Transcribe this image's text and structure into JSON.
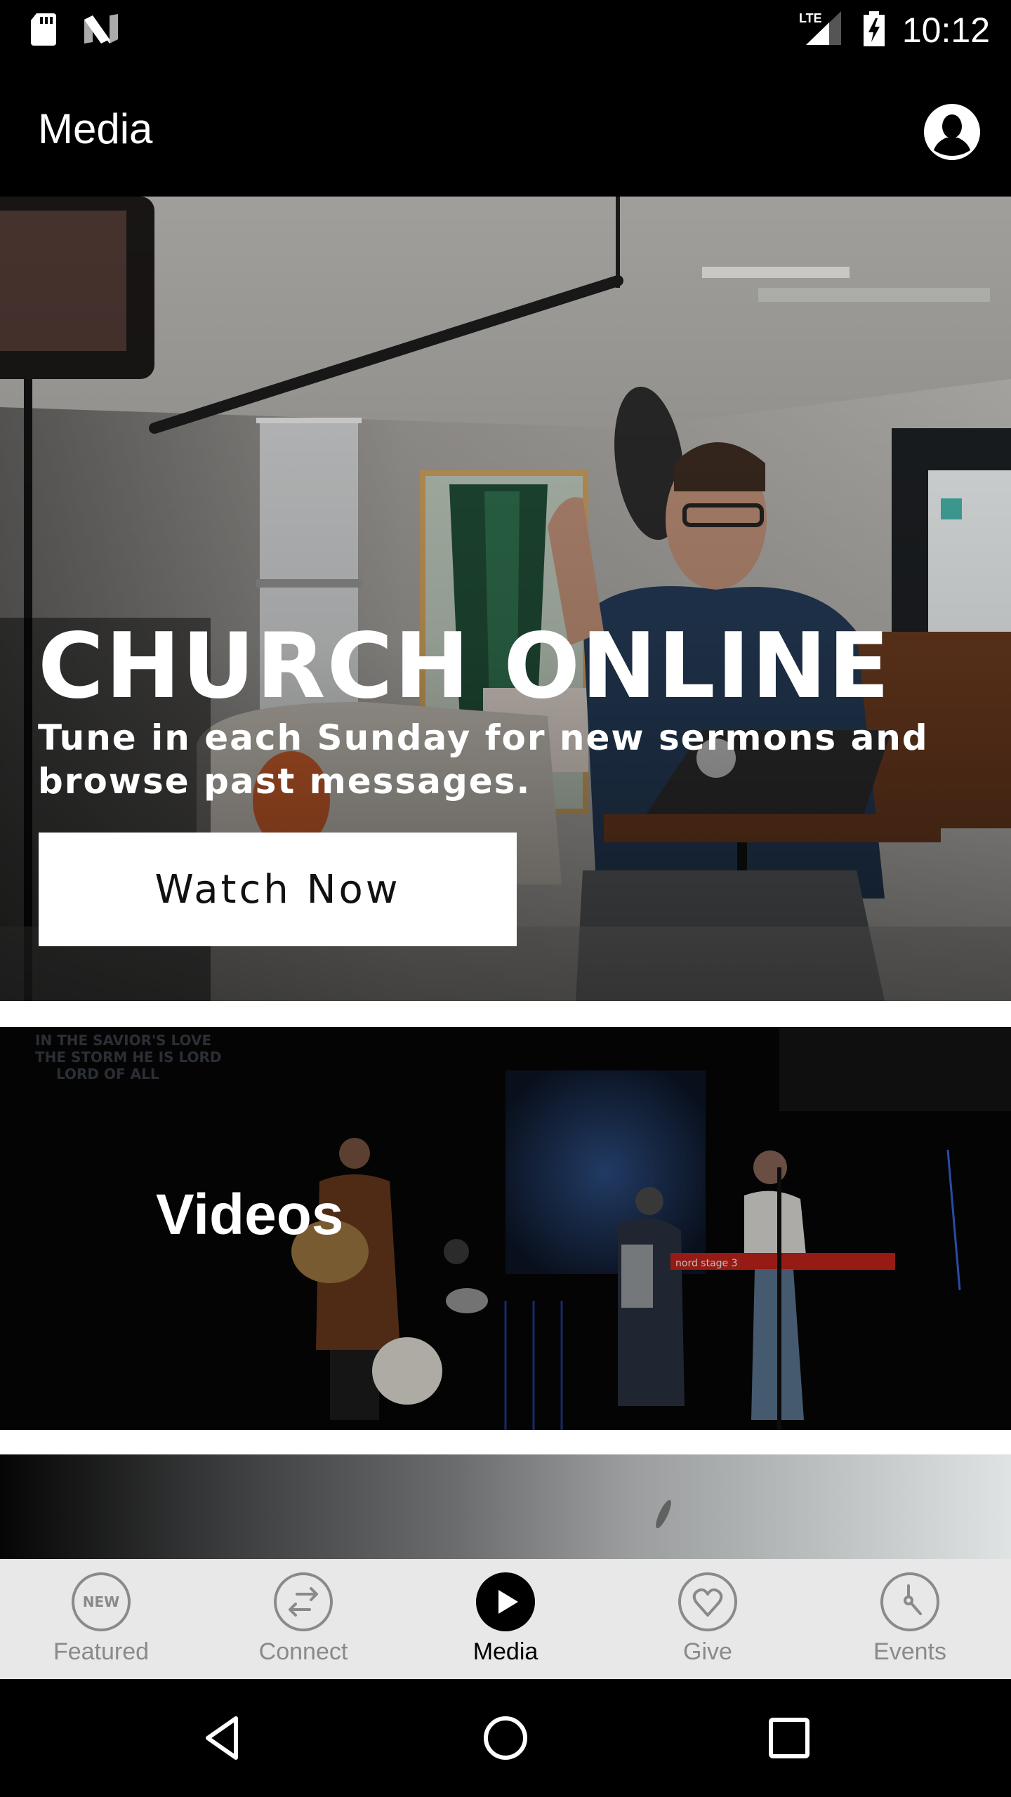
{
  "status_bar": {
    "time": "10:12",
    "left_icons": [
      "sd-card-icon",
      "android-n-icon"
    ],
    "right_icons": [
      "lte-signal-icon",
      "battery-charging-icon"
    ],
    "network_label": "LTE"
  },
  "app_bar": {
    "title": "Media",
    "profile_icon": "account-circle-icon"
  },
  "feed": {
    "hero": {
      "title": "CHURCH ONLINE",
      "subtitle": "Tune in each Sunday for new sermons and browse past messages.",
      "button_label": "Watch Now"
    },
    "videos_card": {
      "label": "Videos"
    },
    "third_card": {
      "label": ""
    }
  },
  "tab_bar": {
    "active": "Media",
    "tabs": [
      {
        "label": "Featured",
        "icon": "new-badge-icon",
        "icon_text": "NEW"
      },
      {
        "label": "Connect",
        "icon": "swap-arrows-icon"
      },
      {
        "label": "Media",
        "icon": "play-circle-icon"
      },
      {
        "label": "Give",
        "icon": "heart-icon"
      },
      {
        "label": "Events",
        "icon": "clock-icon"
      }
    ]
  },
  "nav_bar": {
    "buttons": [
      "back",
      "home",
      "recents"
    ]
  },
  "colors": {
    "status_bar_bg": "#000000",
    "app_bar_bg": "#000000",
    "tab_bar_bg": "#e8e8e8",
    "tab_inactive": "#8a8a8a",
    "tab_active": "#000000"
  }
}
